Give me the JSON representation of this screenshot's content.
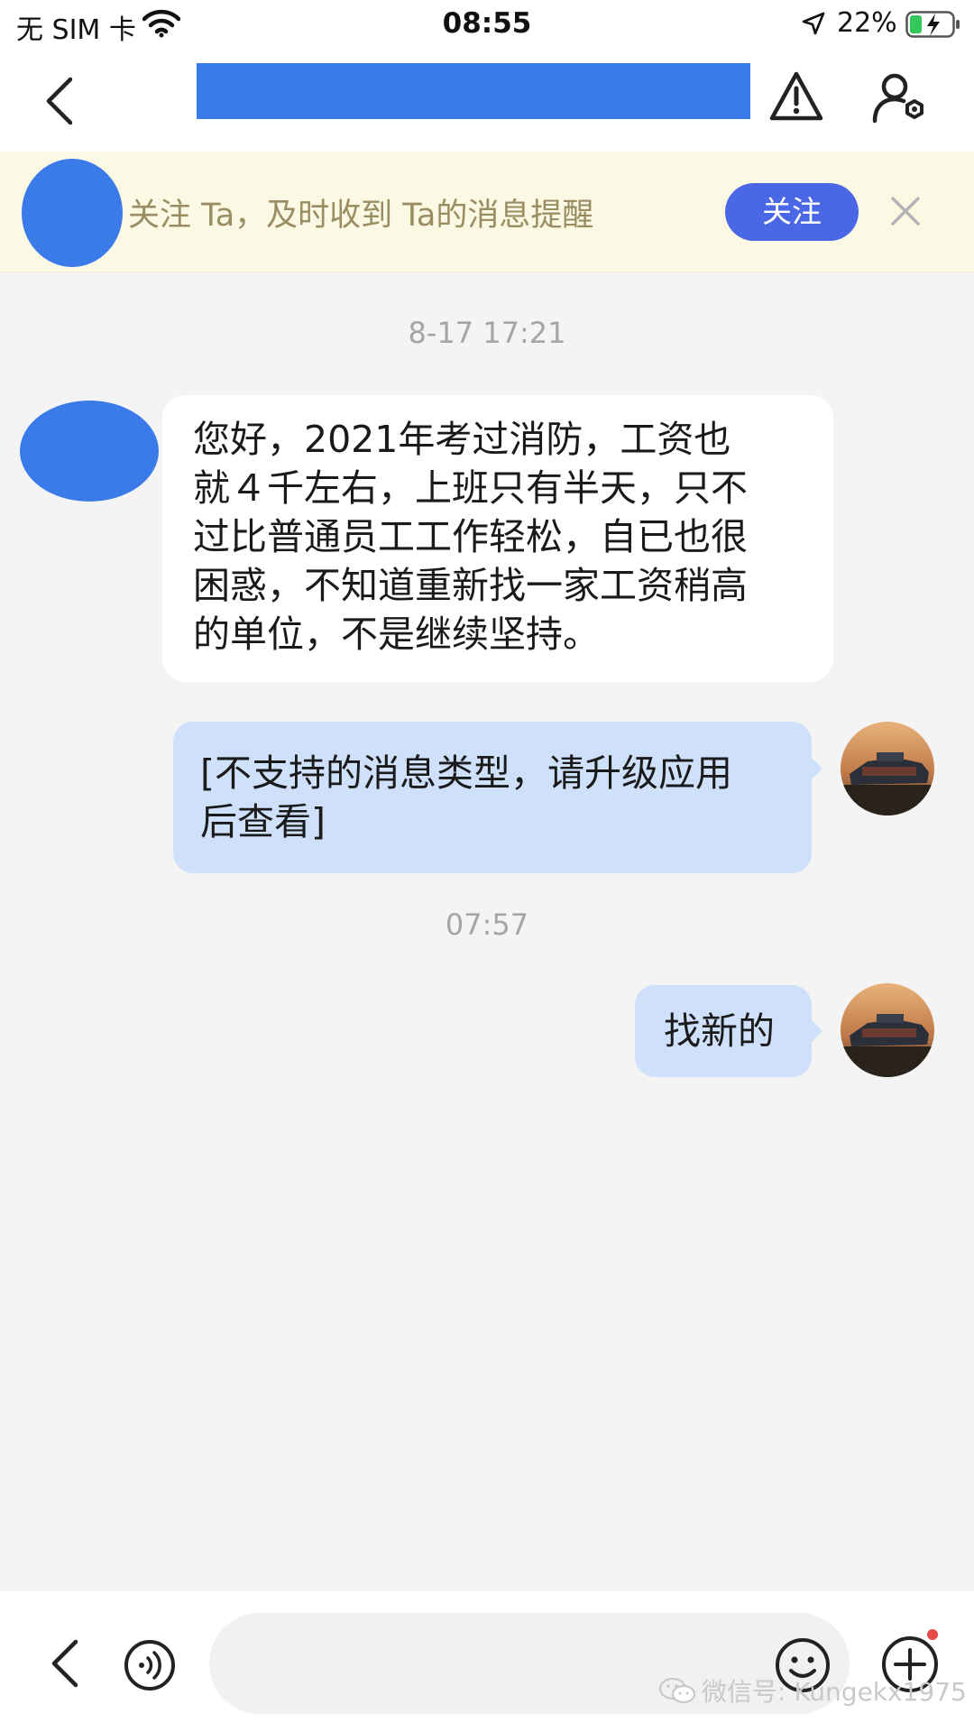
{
  "status_bar": {
    "carrier": "无 SIM 卡",
    "time": "08:55",
    "battery": "22%"
  },
  "nav": {
    "title": ""
  },
  "follow_banner": {
    "text": "关注 Ta，及时收到 Ta的消息提醒",
    "button": "关注"
  },
  "messages": [
    {
      "type": "timestamp",
      "text": "8-17 17:21"
    },
    {
      "type": "incoming",
      "lines": [
        "您好，2021年考过消防，工资也",
        "就４千左右，上班只有半天，只不",
        "过比普通员工工作轻松，自已也很",
        "困惑，不知道重新找一家工资稍高",
        "的单位，不是继续坚持。"
      ]
    },
    {
      "type": "outgoing",
      "lines": [
        "[不支持的消息类型，请升级应用",
        "后查看]"
      ]
    },
    {
      "type": "timestamp",
      "text": "07:57"
    },
    {
      "type": "outgoing",
      "lines": [
        "找新的"
      ]
    }
  ],
  "input_bar": {
    "placeholder": "",
    "watermark": "微信号: Kungekx1975"
  },
  "colors": {
    "redaction_blue": "#3b7be9",
    "follow_button": "#4a68e6",
    "outgoing_bubble": "#cfe0fb",
    "banner_bg": "#fbf8e4"
  }
}
